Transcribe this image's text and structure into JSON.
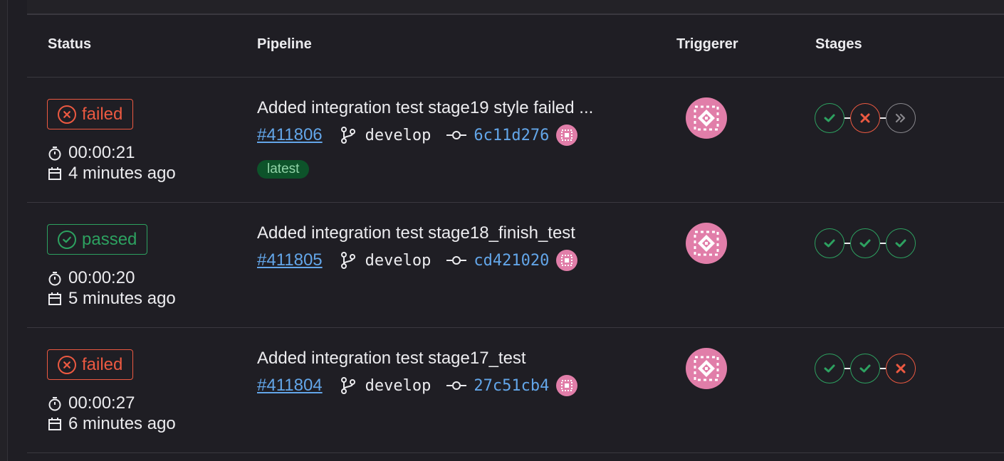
{
  "headers": {
    "status": "Status",
    "pipeline": "Pipeline",
    "triggerer": "Triggerer",
    "stages": "Stages"
  },
  "colors": {
    "failed": "#ec5941",
    "passed": "#2da160",
    "link": "#63a6e9",
    "avatar": "#e17ea9"
  },
  "rows": [
    {
      "status": "failed",
      "status_label": "failed",
      "duration": "00:00:21",
      "finished": "4 minutes ago",
      "title": "Added integration test stage19 style failed ...",
      "pipeline_id": "#411806",
      "branch": "develop",
      "sha": "6c11d276",
      "tag": "latest",
      "stages": [
        "success",
        "failed",
        "skipped"
      ]
    },
    {
      "status": "passed",
      "status_label": "passed",
      "duration": "00:00:20",
      "finished": "5 minutes ago",
      "title": "Added integration test stage18_finish_test",
      "pipeline_id": "#411805",
      "branch": "develop",
      "sha": "cd421020",
      "tag": "",
      "stages": [
        "success",
        "success",
        "success"
      ]
    },
    {
      "status": "failed",
      "status_label": "failed",
      "duration": "00:00:27",
      "finished": "6 minutes ago",
      "title": "Added integration test stage17_test",
      "pipeline_id": "#411804",
      "branch": "develop",
      "sha": "27c51cb4",
      "tag": "",
      "stages": [
        "success",
        "success",
        "failed"
      ]
    }
  ]
}
